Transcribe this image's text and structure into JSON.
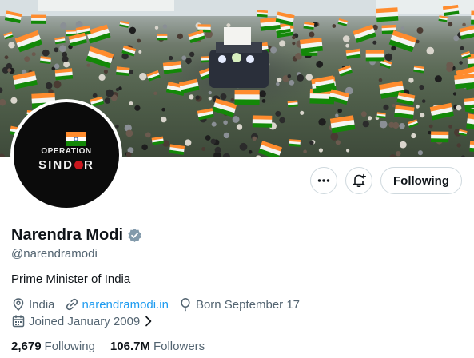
{
  "profile": {
    "name": "Narendra Modi",
    "handle": "@narendramodi",
    "bio": "Prime Minister of India",
    "location": "India",
    "website": "narendramodi.in",
    "birthday": "Born September 17",
    "joined": "Joined January 2009",
    "following_count": "2,679",
    "following_label": "Following",
    "followers_count": "106.7M",
    "followers_label": "Followers",
    "verified": true
  },
  "avatar": {
    "line1": "OPERATION",
    "line2_start": "SIND",
    "line2_end": "R"
  },
  "actions": {
    "follow_state_label": "Following",
    "more_icon": "more-icon",
    "notify_icon": "bell-plus-icon"
  },
  "colors": {
    "accent": "#1d9bf0",
    "secondary_text": "#536471",
    "saffron": "#ff8c2e",
    "green": "#138808"
  }
}
